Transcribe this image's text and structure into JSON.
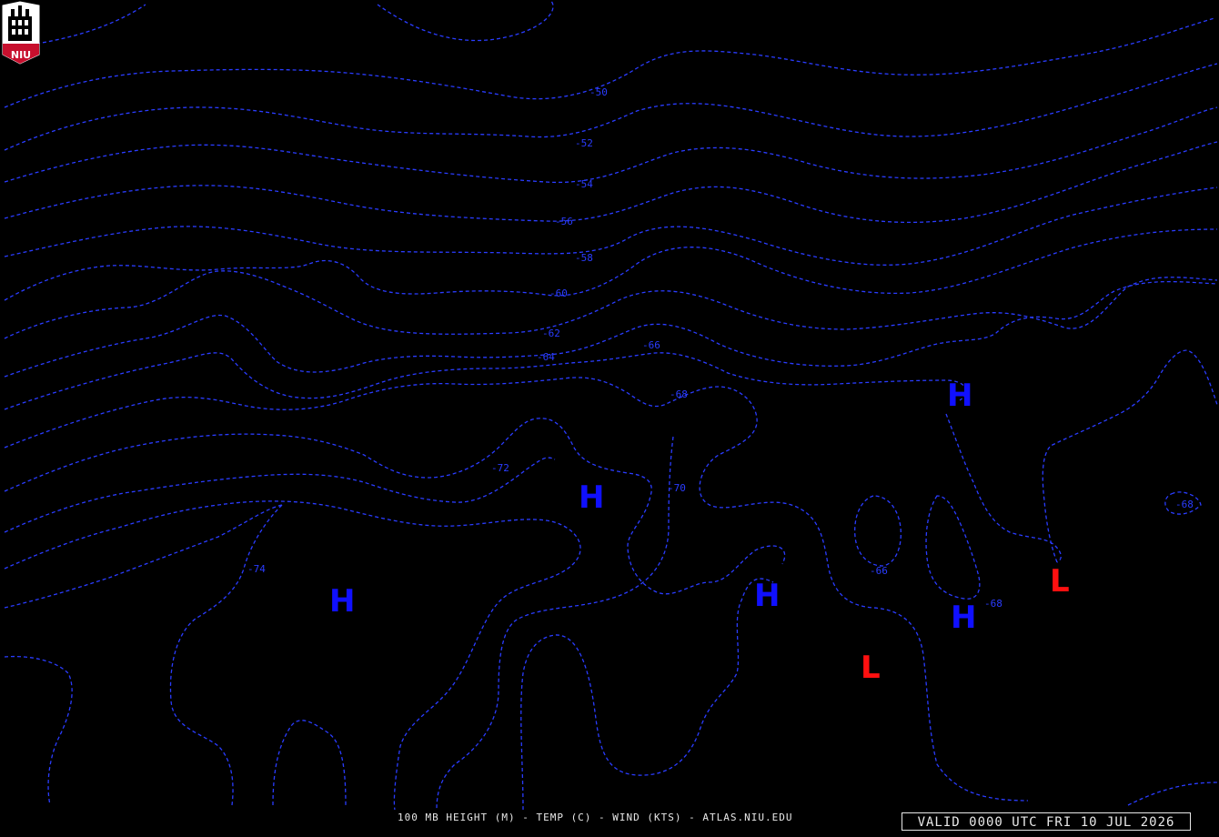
{
  "map": {
    "contour_labels": [
      "-50",
      "-52",
      "-54",
      "-56",
      "-58",
      "-60",
      "-62",
      "-64",
      "-66",
      "-68",
      "-70",
      "-72",
      "-74",
      "-66",
      "-68",
      "-68"
    ],
    "pressure_centers": [
      {
        "type": "H",
        "color": "#1010ff"
      },
      {
        "type": "H",
        "color": "#1010ff"
      },
      {
        "type": "H",
        "color": "#1010ff"
      },
      {
        "type": "H",
        "color": "#1010ff"
      },
      {
        "type": "H",
        "color": "#1010ff"
      },
      {
        "type": "L",
        "color": "#ff1010"
      },
      {
        "type": "L",
        "color": "#ff1010"
      }
    ],
    "contour_color": "#2a3cff"
  },
  "logo": {
    "text": "NIU",
    "color": "#c8102e"
  },
  "footer": {
    "caption": "100 MB HEIGHT (M) - TEMP (C) - WIND (KTS) - ATLAS.NIU.EDU",
    "valid": "VALID 0000 UTC FRI 10 JUL 2026"
  }
}
